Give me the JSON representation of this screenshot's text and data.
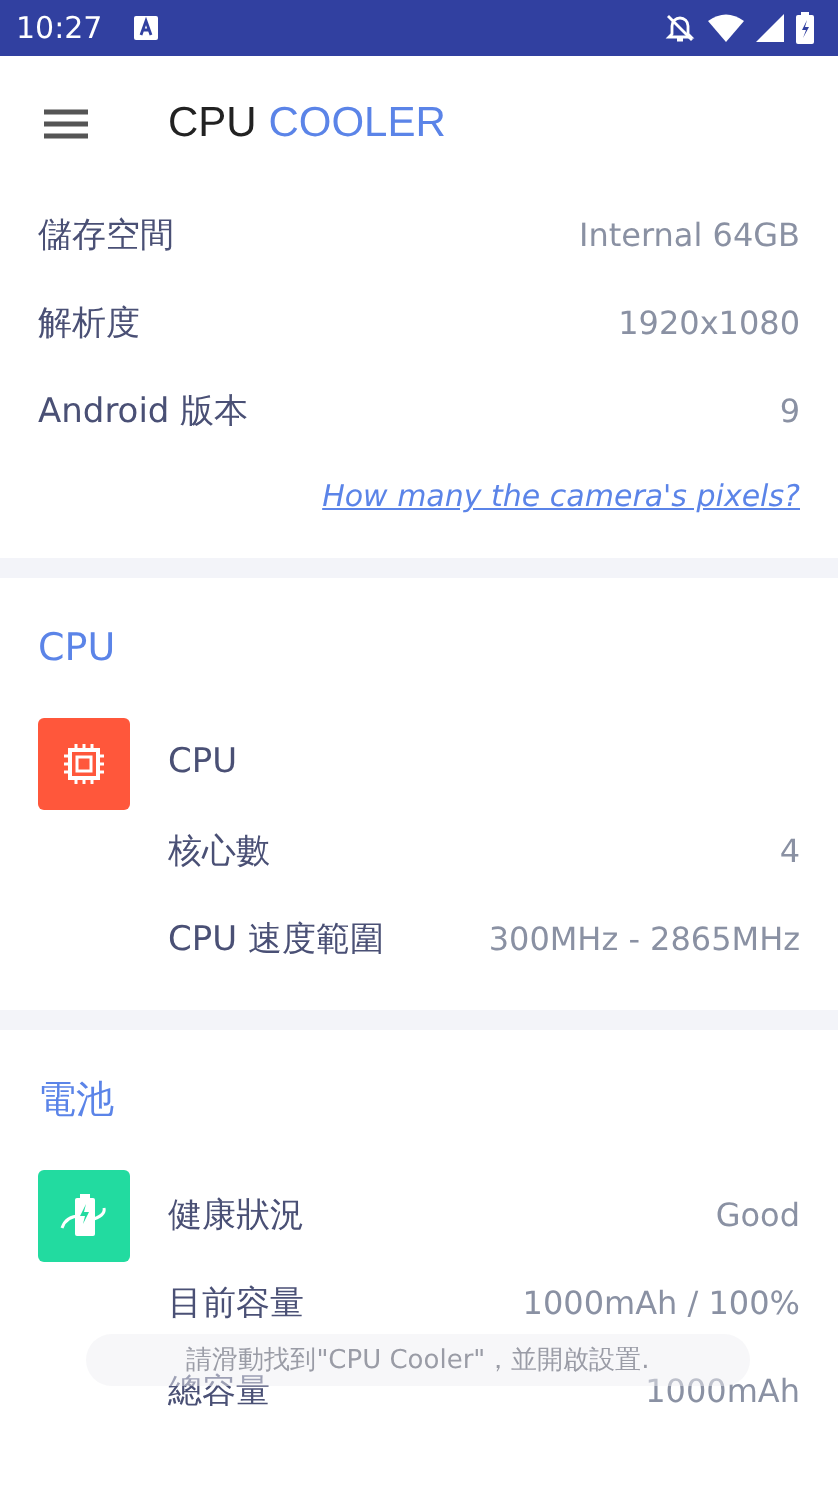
{
  "status_bar": {
    "time": "10:27"
  },
  "app_bar": {
    "title": "CPU",
    "title_accent": "COOLER"
  },
  "device_info": {
    "rows": [
      {
        "label": "儲存空間",
        "value": "Internal 64GB"
      },
      {
        "label": "解析度",
        "value": "1920x1080"
      },
      {
        "label": "Android 版本",
        "value": "9"
      }
    ],
    "link": "How many the camera's pixels?"
  },
  "sections": [
    {
      "title": "CPU",
      "kind": "chip",
      "color": "#ff573b",
      "rows": [
        {
          "label": "CPU"
        },
        {
          "label": "核心數",
          "value": "4"
        },
        {
          "label": "CPU 速度範圍",
          "value": "300MHz - 2865MHz"
        }
      ]
    },
    {
      "title": "電池",
      "kind": "battery",
      "color": "#22dba0",
      "rows": [
        {
          "label": "健康狀況",
          "value": "Good"
        },
        {
          "label": "目前容量",
          "value": "1000mAh / 100%"
        },
        {
          "label": "總容量",
          "value": "1000mAh"
        }
      ]
    }
  ],
  "toast": {
    "text": "請滑動找到\"CPU Cooler\"，並開啟設置."
  }
}
